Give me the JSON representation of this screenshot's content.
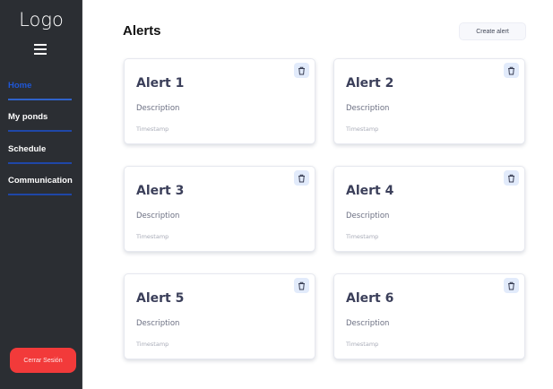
{
  "sidebar": {
    "logo": "Logo",
    "items": [
      {
        "label": "Home"
      },
      {
        "label": "My ponds"
      },
      {
        "label": "Schedule"
      },
      {
        "label": "Communication"
      }
    ],
    "logout": "Cerrar Sesión"
  },
  "header": {
    "title": "Alerts",
    "create": "Create alert"
  },
  "alerts": [
    {
      "title": "Alert 1",
      "description": "Description",
      "timestamp": "Timestamp"
    },
    {
      "title": "Alert 2",
      "description": "Description",
      "timestamp": "Timestamp"
    },
    {
      "title": "Alert 3",
      "description": "Description",
      "timestamp": "Timestamp"
    },
    {
      "title": "Alert 4",
      "description": "Description",
      "timestamp": "Timestamp"
    },
    {
      "title": "Alert 5",
      "description": "Description",
      "timestamp": "Timestamp"
    },
    {
      "title": "Alert 6",
      "description": "Description",
      "timestamp": "Timestamp"
    }
  ]
}
